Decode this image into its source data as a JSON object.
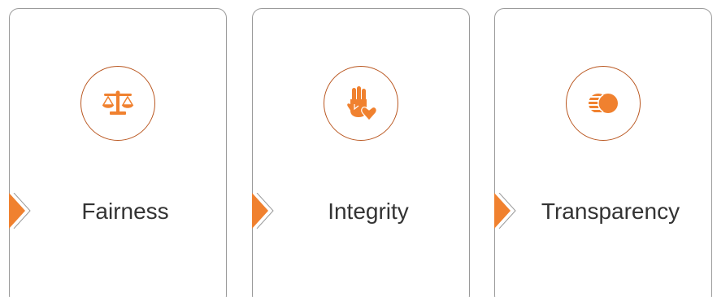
{
  "colors": {
    "accent": "#F0812F",
    "ring": "#B9561F",
    "card_border": "#9A9A9A",
    "text": "#333333"
  },
  "cards": [
    {
      "label": "Fairness",
      "icon": "scales-icon"
    },
    {
      "label": "Integrity",
      "icon": "hand-heart-icon"
    },
    {
      "label": "Transparency",
      "icon": "overlapping-circles-icon"
    }
  ]
}
